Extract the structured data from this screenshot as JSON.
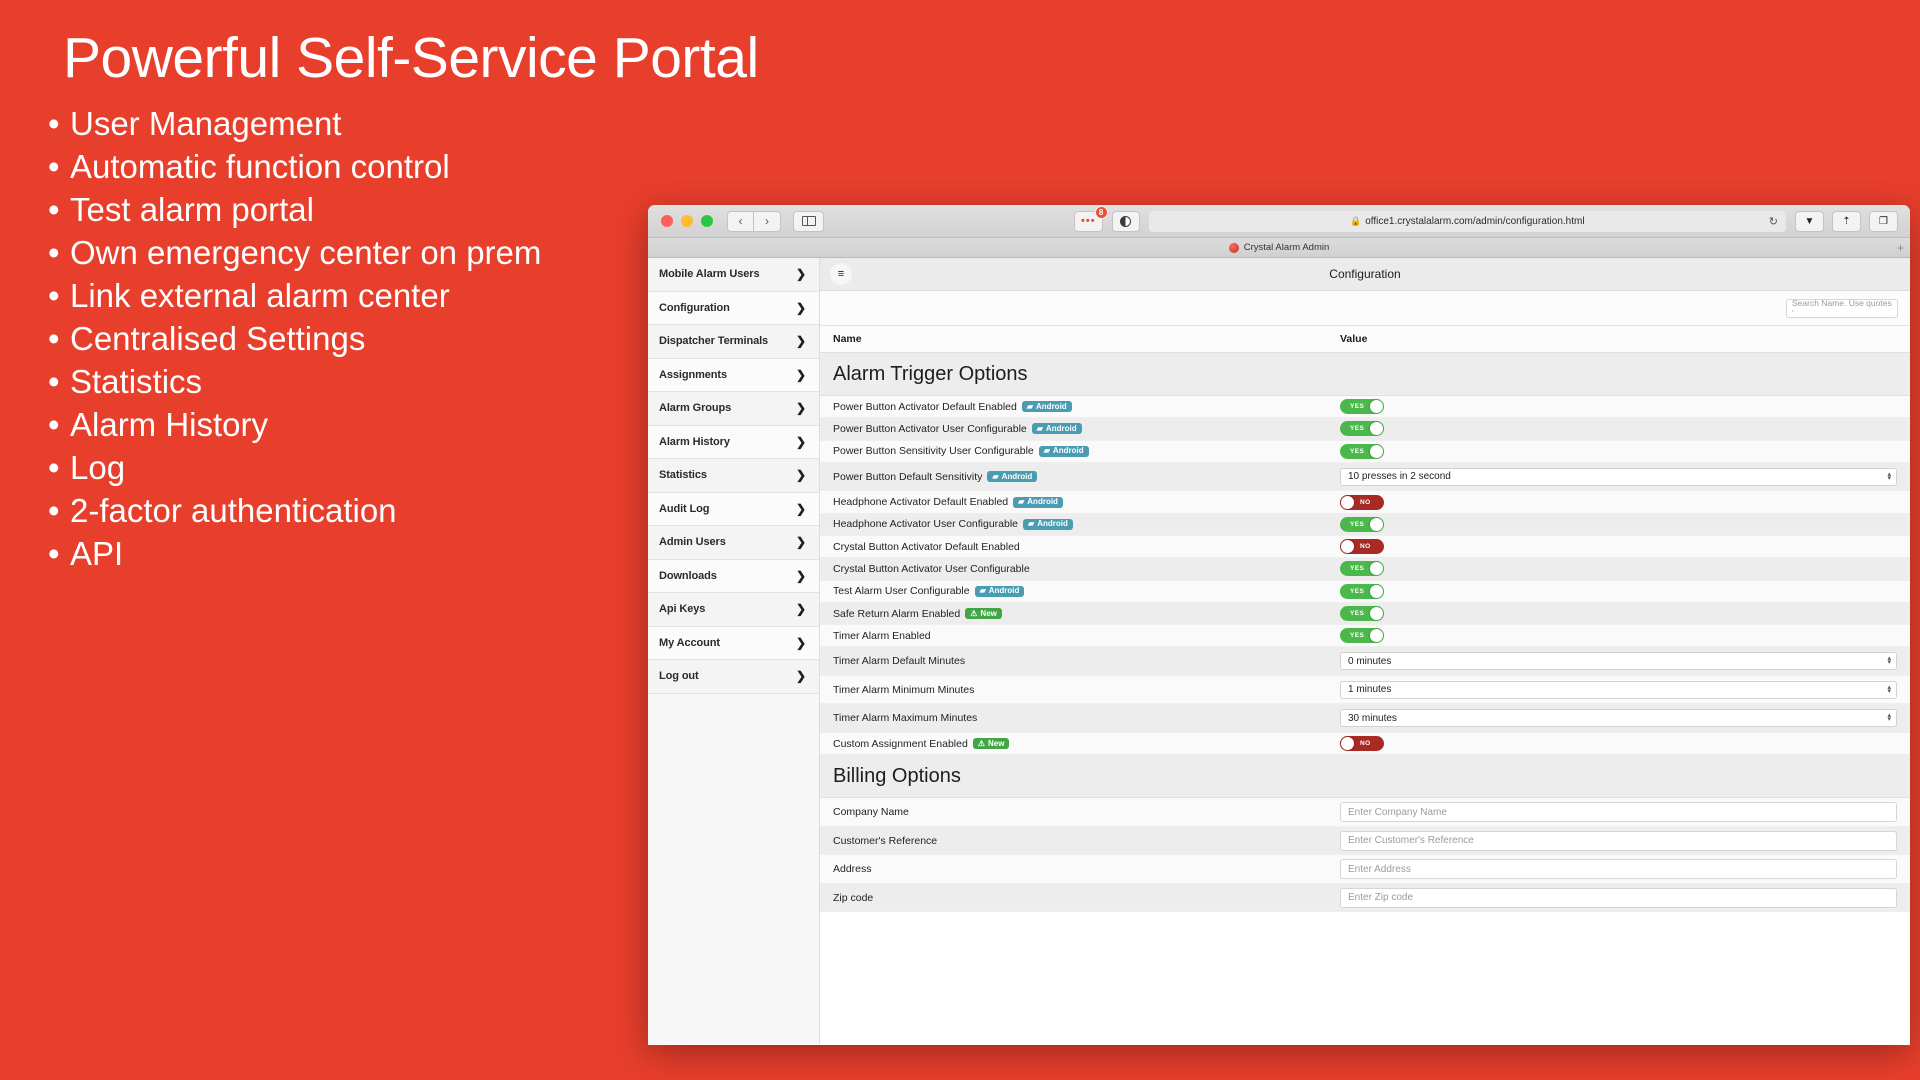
{
  "promo": {
    "title": "Powerful Self-Service Portal",
    "bullets": [
      "User Management",
      "Automatic function control",
      "Test alarm portal",
      "Own emergency center on prem",
      "Link external alarm center",
      "Centralised Settings",
      "Statistics",
      "Alarm History",
      "Log",
      "2-factor authentication",
      "API"
    ],
    "bullet_glyph": "•",
    "background_color": "#E83E2C",
    "text_color": "#FFFFFF"
  },
  "browser": {
    "back_glyph": "‹",
    "forward_glyph": "›",
    "sidebar_toggle_name": "sidebar-toggle",
    "extension_dots": "•••",
    "extension_badge_count": "8",
    "reader_icon": "reader-mode",
    "url": "office1.crystalalarm.com/admin/configuration.html",
    "lock_glyph": "🔒",
    "reload_glyph": "↻",
    "download_glyph": "⬇",
    "share_glyph": "⬆",
    "tabs_glyph": "❐",
    "tab_title": "Crystal Alarm Admin",
    "new_tab_glyph": "+"
  },
  "sidenav": {
    "chevron": "❯",
    "items": [
      {
        "label": "Mobile Alarm Users"
      },
      {
        "label": "Configuration"
      },
      {
        "label": "Dispatcher Terminals"
      },
      {
        "label": "Assignments"
      },
      {
        "label": "Alarm Groups"
      },
      {
        "label": "Alarm History"
      },
      {
        "label": "Statistics"
      },
      {
        "label": "Audit Log"
      },
      {
        "label": "Admin Users"
      },
      {
        "label": "Downloads"
      },
      {
        "label": "Api Keys"
      },
      {
        "label": "My Account"
      },
      {
        "label": "Log out"
      }
    ]
  },
  "app": {
    "hamburger_glyph": "≡",
    "title": "Configuration",
    "search_placeholder": "Search Name. Use quotes '",
    "col_name": "Name",
    "col_value": "Value",
    "badge_android_label": "Android",
    "badge_android_glyph": "▰",
    "badge_android_color": "#4A9CB3",
    "badge_new_label": "New",
    "badge_new_glyph": "⚠",
    "badge_new_color": "#44A544",
    "toggle_yes_label": "YES",
    "toggle_no_label": "NO",
    "toggle_yes_color": "#4AB84A",
    "toggle_no_color": "#A72A25",
    "spinner_up": "▴",
    "spinner_down": "▾",
    "sections": [
      {
        "heading": "Alarm Trigger Options",
        "rows": [
          {
            "name": "Power Button Activator Default Enabled",
            "badge": "android",
            "control": "toggle",
            "value": "YES"
          },
          {
            "name": "Power Button Activator User Configurable",
            "badge": "android",
            "control": "toggle",
            "value": "YES"
          },
          {
            "name": "Power Button Sensitivity User Configurable",
            "badge": "android",
            "control": "toggle",
            "value": "YES"
          },
          {
            "name": "Power Button Default Sensitivity",
            "badge": "android",
            "control": "select",
            "value": "10 presses in 2 second"
          },
          {
            "name": "Headphone Activator Default Enabled",
            "badge": "android",
            "control": "toggle",
            "value": "NO"
          },
          {
            "name": "Headphone Activator User Configurable",
            "badge": "android",
            "control": "toggle",
            "value": "YES"
          },
          {
            "name": "Crystal Button Activator Default Enabled",
            "badge": null,
            "control": "toggle",
            "value": "NO"
          },
          {
            "name": "Crystal Button Activator User Configurable",
            "badge": null,
            "control": "toggle",
            "value": "YES"
          },
          {
            "name": "Test Alarm User Configurable",
            "badge": "android",
            "control": "toggle",
            "value": "YES"
          },
          {
            "name": "Safe Return Alarm Enabled",
            "badge": "new",
            "control": "toggle",
            "value": "YES"
          },
          {
            "name": "Timer Alarm Enabled",
            "badge": null,
            "control": "toggle",
            "value": "YES"
          },
          {
            "name": "Timer Alarm Default Minutes",
            "badge": null,
            "control": "select",
            "value": "0 minutes"
          },
          {
            "name": "Timer Alarm Minimum Minutes",
            "badge": null,
            "control": "select",
            "value": "1 minutes"
          },
          {
            "name": "Timer Alarm Maximum Minutes",
            "badge": null,
            "control": "select",
            "value": "30 minutes"
          },
          {
            "name": "Custom Assignment Enabled",
            "badge": "new",
            "control": "toggle",
            "value": "NO"
          }
        ]
      },
      {
        "heading": "Billing Options",
        "rows": [
          {
            "name": "Company Name",
            "badge": null,
            "control": "input",
            "value": "Enter Company Name"
          },
          {
            "name": "Customer's Reference",
            "badge": null,
            "control": "input",
            "value": "Enter Customer's Reference"
          },
          {
            "name": "Address",
            "badge": null,
            "control": "input",
            "value": "Enter Address"
          },
          {
            "name": "Zip code",
            "badge": null,
            "control": "input",
            "value": "Enter Zip code"
          }
        ]
      }
    ]
  }
}
